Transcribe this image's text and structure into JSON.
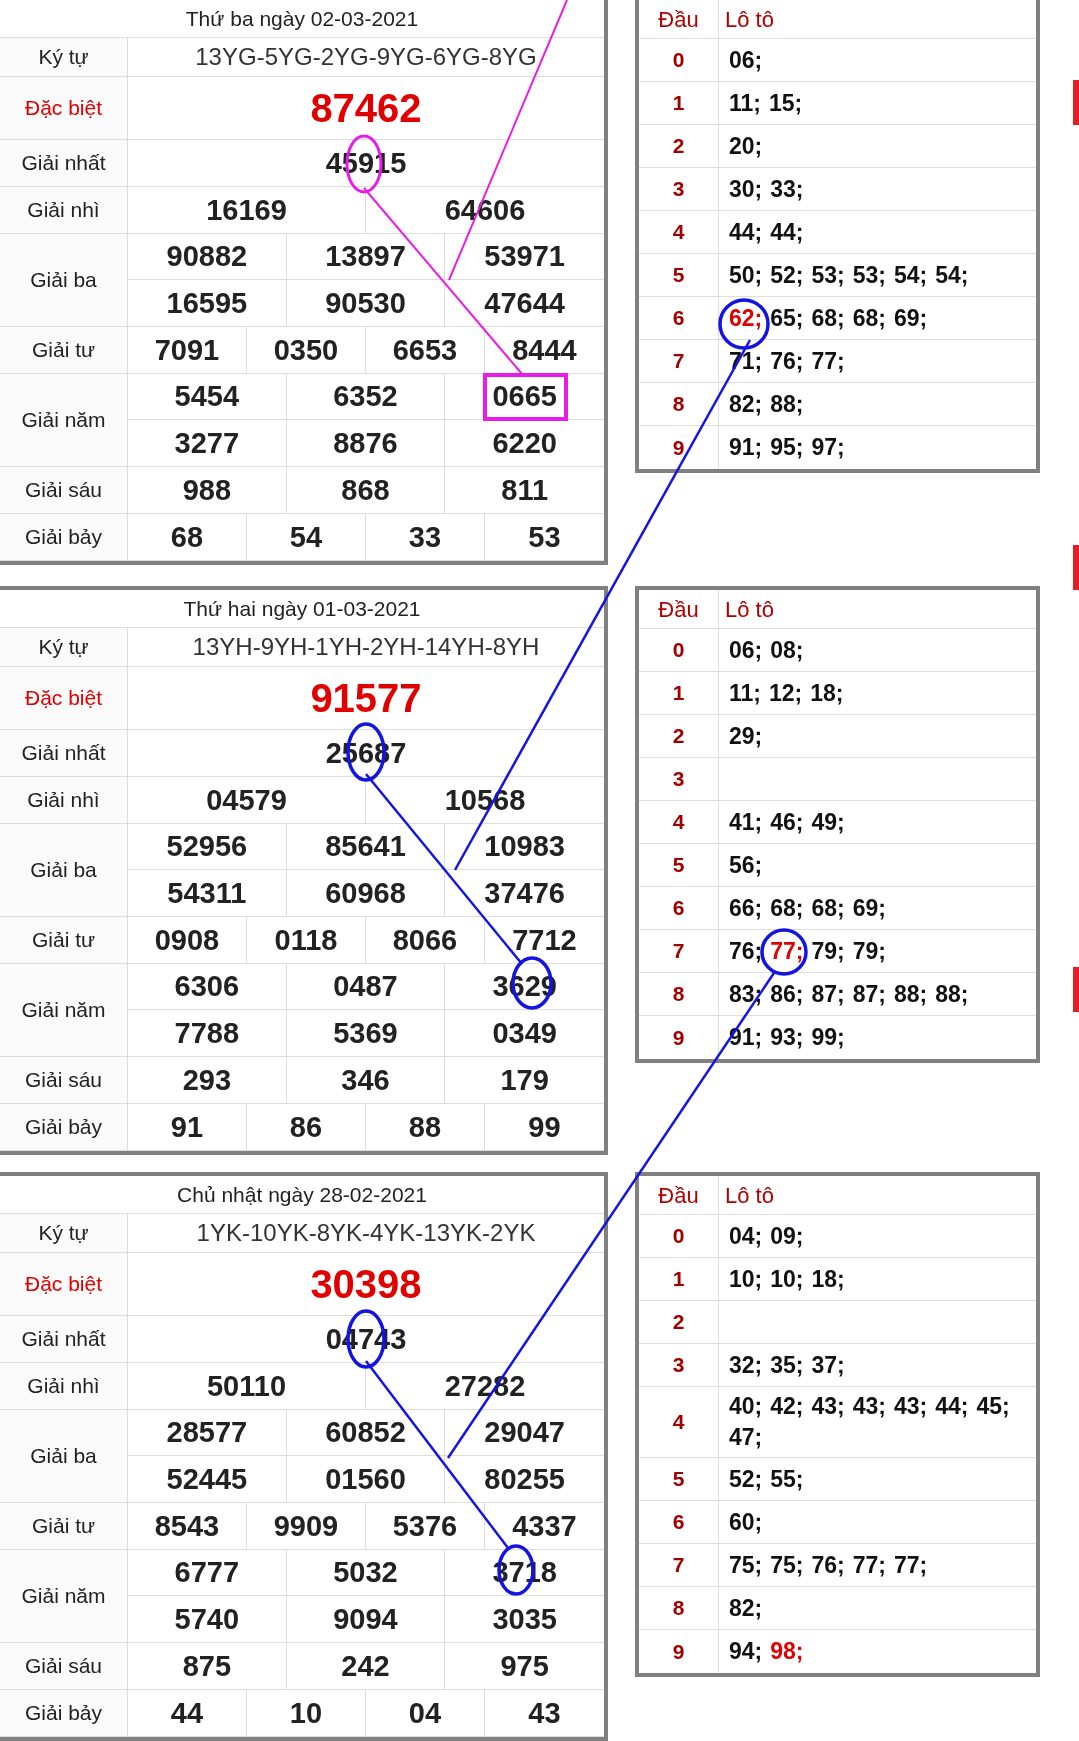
{
  "draws": [
    {
      "date_title": "Thứ ba ngày 02-03-2021",
      "prizes": [
        {
          "label": "Ký tự",
          "kind": "code",
          "numbers": [
            "13YG-5YG-2YG-9YG-6YG-8YG"
          ]
        },
        {
          "label": "Đặc biệt",
          "kind": "special",
          "numbers": [
            "87462"
          ]
        },
        {
          "label": "Giải nhất",
          "kind": "single",
          "numbers": [
            "45915"
          ]
        },
        {
          "label": "Giải nhì",
          "kind": "pair",
          "numbers": [
            "16169",
            "64606"
          ]
        },
        {
          "label": "Giải ba",
          "kind": "triple",
          "numbers": [
            "90882",
            "13897",
            "53971",
            "16595",
            "90530",
            "47644"
          ]
        },
        {
          "label": "Giải tư",
          "kind": "quad",
          "numbers": [
            "7091",
            "0350",
            "6653",
            "8444"
          ]
        },
        {
          "label": "Giải năm",
          "kind": "triple",
          "numbers": [
            "5454",
            "6352",
            "0665",
            "3277",
            "8876",
            "6220"
          ]
        },
        {
          "label": "Giải sáu",
          "kind": "triple",
          "numbers": [
            "988",
            "868",
            "811"
          ]
        },
        {
          "label": "Giải bảy",
          "kind": "quad",
          "numbers": [
            "68",
            "54",
            "33",
            "53"
          ]
        }
      ],
      "loto": {
        "head_label": "Đầu",
        "values_label": "Lô tô",
        "rows": [
          {
            "digit": "0",
            "numbers": [
              {
                "text": "06;",
                "highlighted": false
              }
            ]
          },
          {
            "digit": "1",
            "numbers": [
              {
                "text": "11;",
                "highlighted": false
              },
              {
                "text": "15;",
                "highlighted": false
              }
            ]
          },
          {
            "digit": "2",
            "numbers": [
              {
                "text": "20;",
                "highlighted": false
              }
            ]
          },
          {
            "digit": "3",
            "numbers": [
              {
                "text": "30;",
                "highlighted": false
              },
              {
                "text": "33;",
                "highlighted": false
              }
            ]
          },
          {
            "digit": "4",
            "numbers": [
              {
                "text": "44;",
                "highlighted": false
              },
              {
                "text": "44;",
                "highlighted": false
              }
            ]
          },
          {
            "digit": "5",
            "numbers": [
              {
                "text": "50;",
                "highlighted": false
              },
              {
                "text": "52;",
                "highlighted": false
              },
              {
                "text": "53;",
                "highlighted": false
              },
              {
                "text": "53;",
                "highlighted": false
              },
              {
                "text": "54;",
                "highlighted": false
              },
              {
                "text": "54;",
                "highlighted": false
              }
            ]
          },
          {
            "digit": "6",
            "numbers": [
              {
                "text": "62;",
                "highlighted": true
              },
              {
                "text": "65;",
                "highlighted": false
              },
              {
                "text": "68;",
                "highlighted": false
              },
              {
                "text": "68;",
                "highlighted": false
              },
              {
                "text": "69;",
                "highlighted": false
              }
            ]
          },
          {
            "digit": "7",
            "numbers": [
              {
                "text": "71;",
                "highlighted": false
              },
              {
                "text": "76;",
                "highlighted": false
              },
              {
                "text": "77;",
                "highlighted": false
              }
            ]
          },
          {
            "digit": "8",
            "numbers": [
              {
                "text": "82;",
                "highlighted": false
              },
              {
                "text": "88;",
                "highlighted": false
              }
            ]
          },
          {
            "digit": "9",
            "numbers": [
              {
                "text": "91;",
                "highlighted": false
              },
              {
                "text": "95;",
                "highlighted": false
              },
              {
                "text": "97;",
                "highlighted": false
              }
            ]
          }
        ]
      }
    },
    {
      "date_title": "Thứ hai ngày 01-03-2021",
      "prizes": [
        {
          "label": "Ký tự",
          "kind": "code",
          "numbers": [
            "13YH-9YH-1YH-2YH-14YH-8YH"
          ]
        },
        {
          "label": "Đặc biệt",
          "kind": "special",
          "numbers": [
            "91577"
          ]
        },
        {
          "label": "Giải nhất",
          "kind": "single",
          "numbers": [
            "25687"
          ]
        },
        {
          "label": "Giải nhì",
          "kind": "pair",
          "numbers": [
            "04579",
            "10568"
          ]
        },
        {
          "label": "Giải ba",
          "kind": "triple",
          "numbers": [
            "52956",
            "85641",
            "10983",
            "54311",
            "60968",
            "37476"
          ]
        },
        {
          "label": "Giải tư",
          "kind": "quad",
          "numbers": [
            "0908",
            "0118",
            "8066",
            "7712"
          ]
        },
        {
          "label": "Giải năm",
          "kind": "triple",
          "numbers": [
            "6306",
            "0487",
            "3629",
            "7788",
            "5369",
            "0349"
          ]
        },
        {
          "label": "Giải sáu",
          "kind": "triple",
          "numbers": [
            "293",
            "346",
            "179"
          ]
        },
        {
          "label": "Giải bảy",
          "kind": "quad",
          "numbers": [
            "91",
            "86",
            "88",
            "99"
          ]
        }
      ],
      "loto": {
        "head_label": "Đầu",
        "values_label": "Lô tô",
        "rows": [
          {
            "digit": "0",
            "numbers": [
              {
                "text": "06;",
                "highlighted": false
              },
              {
                "text": "08;",
                "highlighted": false
              }
            ]
          },
          {
            "digit": "1",
            "numbers": [
              {
                "text": "11;",
                "highlighted": false
              },
              {
                "text": "12;",
                "highlighted": false
              },
              {
                "text": "18;",
                "highlighted": false
              }
            ]
          },
          {
            "digit": "2",
            "numbers": [
              {
                "text": "29;",
                "highlighted": false
              }
            ]
          },
          {
            "digit": "3"
          },
          {
            "digit": "4",
            "numbers": [
              {
                "text": "41;",
                "highlighted": false
              },
              {
                "text": "46;",
                "highlighted": false
              },
              {
                "text": "49;",
                "highlighted": false
              }
            ]
          },
          {
            "digit": "5",
            "numbers": [
              {
                "text": "56;",
                "highlighted": false
              }
            ]
          },
          {
            "digit": "6",
            "numbers": [
              {
                "text": "66;",
                "highlighted": false
              },
              {
                "text": "68;",
                "highlighted": false
              },
              {
                "text": "68;",
                "highlighted": false
              },
              {
                "text": "69;",
                "highlighted": false
              }
            ]
          },
          {
            "digit": "7",
            "numbers": [
              {
                "text": "76;",
                "highlighted": false
              },
              {
                "text": "77;",
                "highlighted": true
              },
              {
                "text": "79;",
                "highlighted": false
              },
              {
                "text": "79;",
                "highlighted": false
              }
            ]
          },
          {
            "digit": "8",
            "numbers": [
              {
                "text": "83;",
                "highlighted": false
              },
              {
                "text": "86;",
                "highlighted": false
              },
              {
                "text": "87;",
                "highlighted": false
              },
              {
                "text": "87;",
                "highlighted": false
              },
              {
                "text": "88;",
                "highlighted": false
              },
              {
                "text": "88;",
                "highlighted": false
              }
            ]
          },
          {
            "digit": "9",
            "numbers": [
              {
                "text": "91;",
                "highlighted": false
              },
              {
                "text": "93;",
                "highlighted": false
              },
              {
                "text": "99;",
                "highlighted": false
              }
            ]
          }
        ]
      }
    },
    {
      "date_title": "Chủ nhật ngày 28-02-2021",
      "prizes": [
        {
          "label": "Ký tự",
          "kind": "code",
          "numbers": [
            "1YK-10YK-8YK-4YK-13YK-2YK"
          ]
        },
        {
          "label": "Đặc biệt",
          "kind": "special",
          "numbers": [
            "30398"
          ]
        },
        {
          "label": "Giải nhất",
          "kind": "single",
          "numbers": [
            "04743"
          ]
        },
        {
          "label": "Giải nhì",
          "kind": "pair",
          "numbers": [
            "50110",
            "27282"
          ]
        },
        {
          "label": "Giải ba",
          "kind": "triple",
          "numbers": [
            "28577",
            "60852",
            "29047",
            "52445",
            "01560",
            "80255"
          ]
        },
        {
          "label": "Giải tư",
          "kind": "quad",
          "numbers": [
            "8543",
            "9909",
            "5376",
            "4337"
          ]
        },
        {
          "label": "Giải năm",
          "kind": "triple",
          "numbers": [
            "6777",
            "5032",
            "3718",
            "5740",
            "9094",
            "3035"
          ]
        },
        {
          "label": "Giải sáu",
          "kind": "triple",
          "numbers": [
            "875",
            "242",
            "975"
          ]
        },
        {
          "label": "Giải bảy",
          "kind": "quad",
          "numbers": [
            "44",
            "10",
            "04",
            "43"
          ]
        }
      ],
      "loto": {
        "head_label": "Đầu",
        "values_label": "Lô tô",
        "rows": [
          {
            "digit": "0",
            "numbers": [
              {
                "text": "04;",
                "highlighted": false
              },
              {
                "text": "09;",
                "highlighted": false
              }
            ]
          },
          {
            "digit": "1",
            "numbers": [
              {
                "text": "10;",
                "highlighted": false
              },
              {
                "text": "10;",
                "highlighted": false
              },
              {
                "text": "18;",
                "highlighted": false
              }
            ]
          },
          {
            "digit": "2"
          },
          {
            "digit": "3",
            "numbers": [
              {
                "text": "32;",
                "highlighted": false
              },
              {
                "text": "35;",
                "highlighted": false
              },
              {
                "text": "37;",
                "highlighted": false
              }
            ]
          },
          {
            "digit": "4",
            "numbers": [
              {
                "text": "40;",
                "highlighted": false
              },
              {
                "text": "42;",
                "highlighted": false
              },
              {
                "text": "43;",
                "highlighted": false
              },
              {
                "text": "43;",
                "highlighted": false
              },
              {
                "text": "43;",
                "highlighted": false
              },
              {
                "text": "44;",
                "highlighted": false
              },
              {
                "text": "45;",
                "highlighted": false
              },
              {
                "text": "47;",
                "highlighted": false
              }
            ]
          },
          {
            "digit": "5",
            "numbers": [
              {
                "text": "52;",
                "highlighted": false
              },
              {
                "text": "55;",
                "highlighted": false
              }
            ]
          },
          {
            "digit": "6",
            "numbers": [
              {
                "text": "60;",
                "highlighted": false
              }
            ]
          },
          {
            "digit": "7",
            "numbers": [
              {
                "text": "75;",
                "highlighted": false
              },
              {
                "text": "75;",
                "highlighted": false
              },
              {
                "text": "76;",
                "highlighted": false
              },
              {
                "text": "77;",
                "highlighted": false
              },
              {
                "text": "77;",
                "highlighted": false
              }
            ]
          },
          {
            "digit": "8",
            "numbers": [
              {
                "text": "82;",
                "highlighted": false
              }
            ]
          },
          {
            "digit": "9",
            "numbers": [
              {
                "text": "94;",
                "highlighted": false
              },
              {
                "text": "98;",
                "highlighted": true
              }
            ]
          }
        ]
      }
    }
  ]
}
